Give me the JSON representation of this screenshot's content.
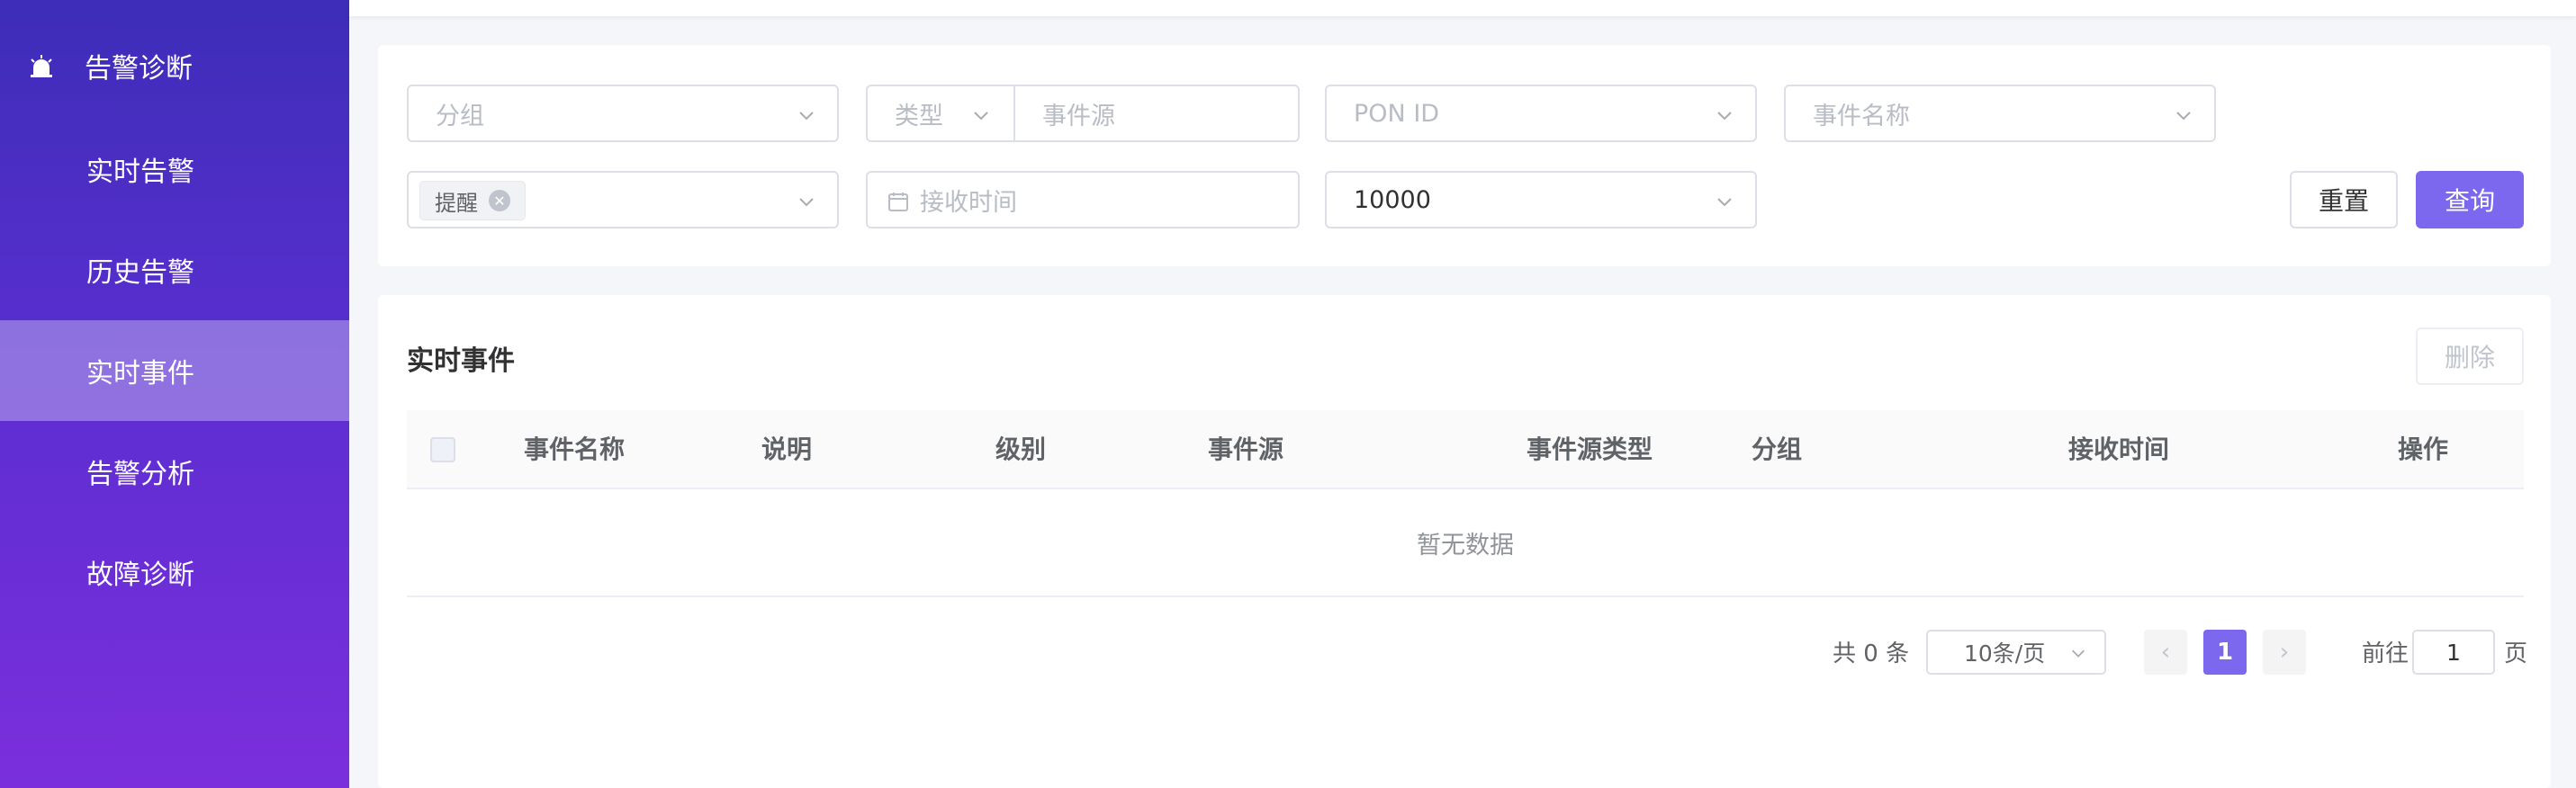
{
  "sidebar": {
    "header": {
      "label": "告警诊断",
      "icon": "alarm-icon"
    },
    "items": [
      {
        "label": "实时告警",
        "active": false
      },
      {
        "label": "历史告警",
        "active": false
      },
      {
        "label": "实时事件",
        "active": true
      },
      {
        "label": "告警分析",
        "active": false
      },
      {
        "label": "故障诊断",
        "active": false
      }
    ]
  },
  "filters": {
    "group_placeholder": "分组",
    "type_placeholder": "类型",
    "event_source_placeholder": "事件源",
    "pon_id_placeholder": "PON ID",
    "event_name_placeholder": "事件名称",
    "level_tag": "提醒",
    "receive_time_placeholder": "接收时间",
    "limit_value": "10000",
    "reset_label": "重置",
    "query_label": "查询"
  },
  "table": {
    "title": "实时事件",
    "delete_label": "删除",
    "columns": [
      "事件名称",
      "说明",
      "级别",
      "事件源",
      "事件源类型",
      "分组",
      "接收时间",
      "操作"
    ],
    "rows": [],
    "empty_text": "暂无数据"
  },
  "pagination": {
    "total_text": "共 0 条",
    "page_size": "10条/页",
    "current_page": "1",
    "prev": "‹",
    "next": "›",
    "goto_prefix": "前往",
    "goto_value": "1",
    "goto_suffix": "页"
  },
  "colors": {
    "primary": "#7b68ee",
    "sidebar_top": "#3d2db8",
    "sidebar_bottom": "#7b2fdc"
  }
}
